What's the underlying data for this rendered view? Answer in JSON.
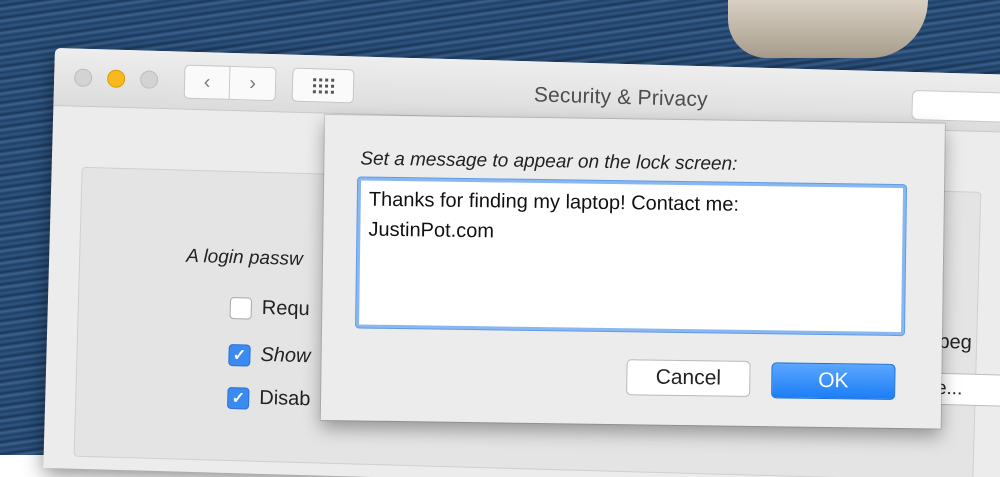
{
  "window": {
    "title": "Security & Privacy",
    "nav_back": "‹",
    "nav_forward": "›"
  },
  "general": {
    "login_text": "A login passw",
    "check_require": {
      "label": "Requ",
      "checked": false
    },
    "check_show": {
      "label": "Show",
      "checked": true
    },
    "check_disable": {
      "label": "Disab",
      "checked": true
    },
    "after_begins": "er beg",
    "set_message_btn": "age..."
  },
  "dialog": {
    "prompt": "Set a message to appear on the lock screen:",
    "message": "Thanks for finding my laptop! Contact me:\nJustinPot.com",
    "cancel_label": "Cancel",
    "ok_label": "OK"
  },
  "colors": {
    "accent": "#3b8af0",
    "minimize": "#f6b91e"
  }
}
